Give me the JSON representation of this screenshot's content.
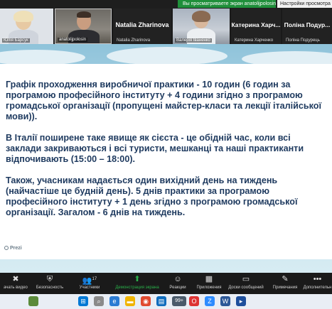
{
  "banner": {
    "share_label": "Вы просматриваете экран anatolijpolosin",
    "view_options": "Настройки просмотра"
  },
  "participants": [
    {
      "name": "Юлія Барсук"
    },
    {
      "name": "anatolijpolosin"
    },
    {
      "title": "Natalia Zharinova",
      "name": "Natalia Zharinova"
    },
    {
      "name": "Валерія Іваненко"
    },
    {
      "title": "Катерина Харч...",
      "name": "Катерина Харченко"
    },
    {
      "title": "Поліна Подур...",
      "name": "Поліна Подурець"
    }
  ],
  "slide": {
    "paragraph1": "Графік проходження виробничої практики - 10 годин (6 годин за програмою професійного інституту + 4 години згідно з програмою громадської організації (пропущені майстер-класи та лекції італійської мови)).",
    "paragraph2": "В Італії поширене таке явище як сієста - це обідній час, коли всі заклади закриваються і всі туристи, мешканці та наші практиканти відпочивають (15:00 – 18:00).",
    "paragraph3": "Також, учасникам надається один вихідний день на тиждень (найчастіше це будній день). 5 днів практики за програмою професійного інституту + 1 день згідно з програмою громадської організації. Загалом - 6 днів на тиждень.",
    "brand": "Prezi"
  },
  "toolbar": {
    "items": [
      {
        "label": "ачать видео",
        "icon": "camera-off-icon"
      },
      {
        "label": "Безопасность",
        "icon": "shield-icon"
      },
      {
        "label": "Участники",
        "icon": "participants-icon",
        "count": "17"
      },
      {
        "label": "Демонстрация экрана",
        "icon": "share-screen-icon"
      },
      {
        "label": "Реакции",
        "icon": "reactions-icon"
      },
      {
        "label": "Приложения",
        "icon": "apps-icon"
      },
      {
        "label": "Доски сообщений",
        "icon": "whiteboard-icon"
      },
      {
        "label": "Примечания",
        "icon": "notes-icon"
      },
      {
        "label": "Дополнительн",
        "icon": "more-icon"
      }
    ]
  },
  "taskbar": {
    "badge": "99+"
  }
}
